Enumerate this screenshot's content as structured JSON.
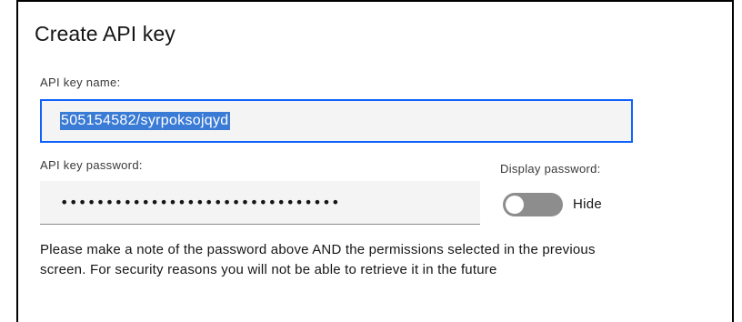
{
  "dialog": {
    "title": "Create API key"
  },
  "name_field": {
    "label": "API key name:",
    "value": "505154582/syrpoksojqyd"
  },
  "password_field": {
    "label": "API key password:",
    "value": "•••••••••••••••••••••••••••••••"
  },
  "display_password": {
    "label": "Display password:",
    "state_text": "Hide",
    "on": false
  },
  "note": {
    "text": "Please make a note of the password above AND the permissions selected in the previous screen. For security reasons you will not be able to retrieve it in the future"
  },
  "colors": {
    "focus_border": "#0f62fe",
    "selection": "#3a7bd5",
    "field_bg": "#f4f4f4",
    "toggle_off": "#8d8d8d"
  }
}
